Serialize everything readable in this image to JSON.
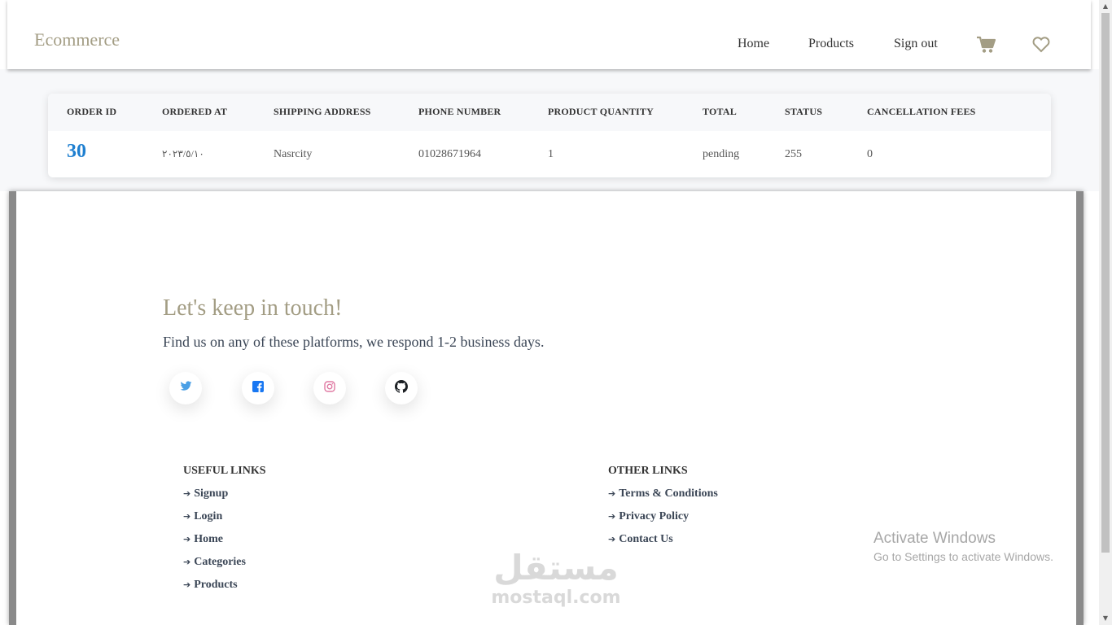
{
  "navbar": {
    "brand": "Ecommerce",
    "links": [
      "Home",
      "Products",
      "Sign out"
    ],
    "icons": [
      "cart-icon",
      "heart-icon"
    ],
    "accent_color": "#a39d84"
  },
  "orders": {
    "headers": [
      "ORDER ID",
      "ORDERED AT",
      "SHIPPING ADDRESS",
      "PHONE NUMBER",
      "PRODUCT QUANTITY",
      "TOTAL",
      "STATUS",
      "CANCELLATION FEES"
    ],
    "rows": [
      {
        "order_id": "30",
        "ordered_at": "٢٠٢٣/٥/١٠",
        "shipping_address": "Nasrcity",
        "phone_number": "01028671964",
        "product_quantity": "1",
        "total": "pending",
        "status": "255",
        "cancellation_fees": "0"
      }
    ],
    "id_color": "#1e7fd0"
  },
  "footer": {
    "title": "Let's keep in touch!",
    "subtitle": "Find us on any of these platforms, we respond 1-2 business days.",
    "socials": [
      "twitter-icon",
      "facebook-icon",
      "instagram-icon",
      "github-icon"
    ],
    "useful_links": {
      "title": "USEFUL LINKS",
      "items": [
        "Signup",
        "Login",
        "Home",
        "Categories",
        "Products"
      ]
    },
    "other_links": {
      "title": "OTHER LINKS",
      "items": [
        "Terms & Conditions",
        "Privacy Policy",
        "Contact Us"
      ]
    }
  },
  "overlays": {
    "activate_line1": "Activate Windows",
    "activate_line2": "Go to Settings to activate Windows.",
    "watermark_ar": "مستقل",
    "watermark_en": "mostaql.com"
  }
}
